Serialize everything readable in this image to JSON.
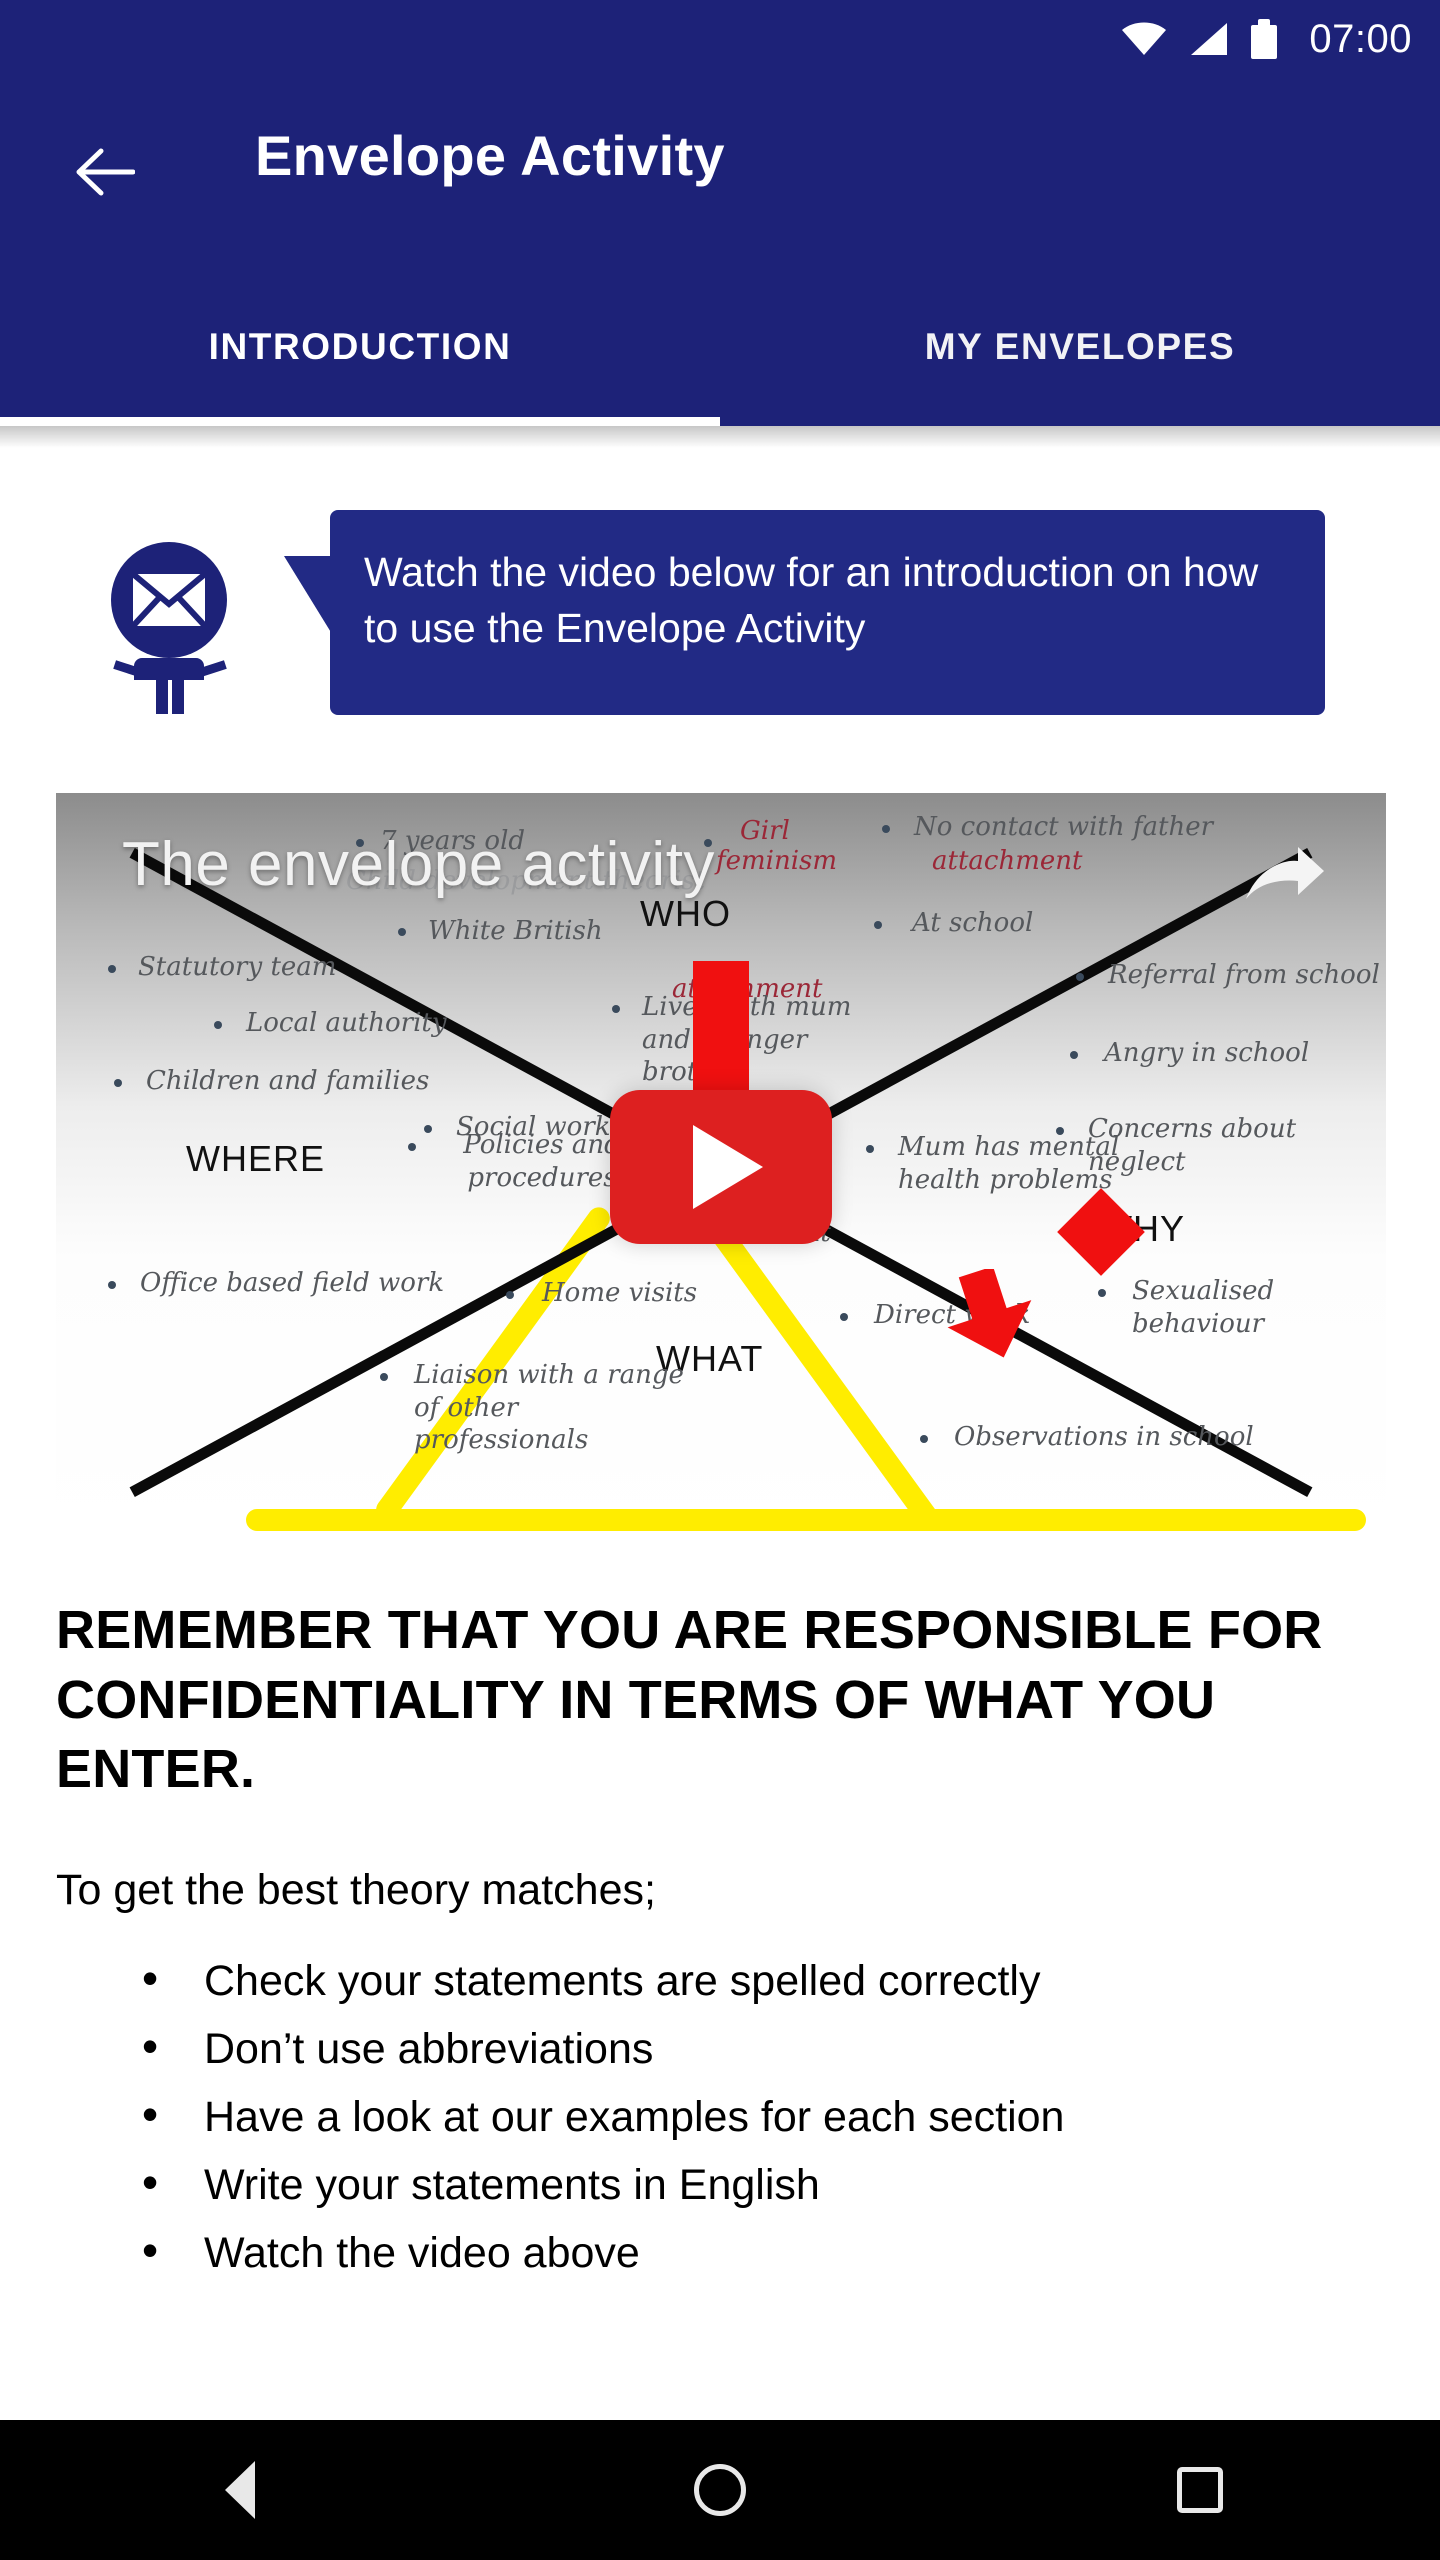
{
  "status_bar": {
    "time": "07:00",
    "icons": [
      "wifi-icon",
      "signal-icon",
      "battery-icon"
    ]
  },
  "app_bar": {
    "back_icon": "arrow-left-icon",
    "title": "Envelope Activity"
  },
  "tabs": [
    {
      "label": "INTRODUCTION",
      "active": true
    },
    {
      "label": "MY ENVELOPES",
      "active": false
    }
  ],
  "hint": {
    "mascot_icon": "envelope-mascot-icon",
    "text": "Watch the video below for an introduction on how to use the Envelope Activity"
  },
  "video": {
    "title": "The envelope activity",
    "play_icon": "youtube-play-icon",
    "share_icon": "share-arrow-icon",
    "quadrant_labels": [
      "WHO",
      "WHERE",
      "WHAT",
      "WHY"
    ],
    "notes": [
      "7 years old",
      "Child development theorist",
      "Girl",
      "feminism",
      "White British",
      "No contact with father",
      "attachment",
      "At school",
      "Statutory team",
      "Local authority",
      "Referral from school",
      "Children and families",
      "Angry in school",
      "Social work",
      "Concerns about neglect",
      "attachment",
      "Lives with mum and younger brother",
      "Policies and procedures",
      "Mum has mental health problems",
      "Sexualised behaviour",
      "Assessment",
      "Office based field work",
      "Home visits",
      "Direct work",
      "Liaison with a range of other professionals",
      "Observations in school"
    ]
  },
  "body": {
    "warning": "REMEMBER THAT YOU ARE RESPONSIBLE FOR CONFIDENTIALITY IN TERMS OF WHAT YOU ENTER.",
    "intro": "To get the best theory matches;",
    "bullets": [
      "Check your statements are spelled correctly",
      "Don’t use abbreviations",
      "Have a look at our examples for each section",
      "Write your statements in English",
      "Watch the video above"
    ]
  },
  "nav_bar": {
    "buttons": [
      "back-icon",
      "home-icon",
      "recents-icon"
    ]
  },
  "colors": {
    "primary": "#1d2278",
    "bubble": "#222a85",
    "accent_red": "#dd2020",
    "highlight_yellow": "#ffed00",
    "nav_background": "#000000"
  }
}
